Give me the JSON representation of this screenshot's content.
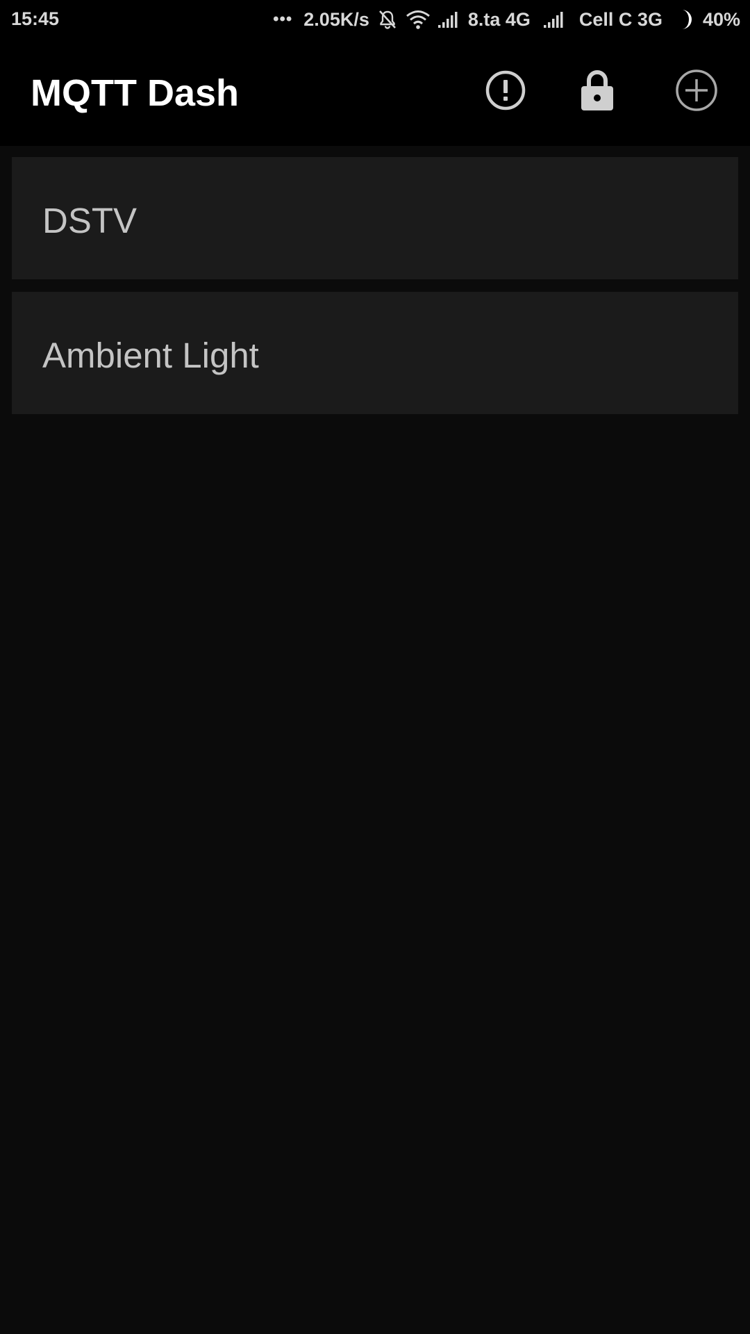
{
  "status_bar": {
    "time": "15:45",
    "dots": "•••",
    "net_speed": "2.05K/s",
    "carrier1": "8.ta 4G",
    "carrier2": "Cell C 3G",
    "battery": "40%",
    "icons": [
      "mute-bell-icon",
      "wifi-icon",
      "signal-icon",
      "signal-icon",
      "battery-icon"
    ]
  },
  "app_bar": {
    "title": "MQTT Dash",
    "actions": [
      "alert-circle-icon",
      "lock-icon",
      "add-circle-icon"
    ]
  },
  "dashboards": [
    {
      "label": "DSTV"
    },
    {
      "label": "Ambient Light"
    }
  ],
  "colors": {
    "background": "#0b0b0b",
    "bar": "#000000",
    "card": "#1b1b1b",
    "card_text": "#c4c4c4",
    "title_text": "#ffffff",
    "icon": "#cfcfcf"
  }
}
